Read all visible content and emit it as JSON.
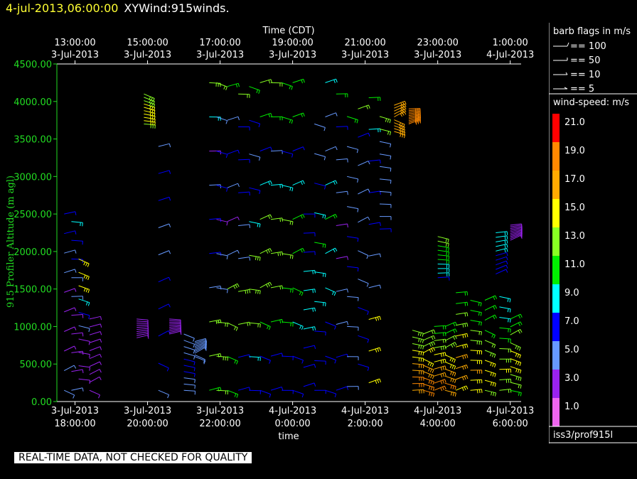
{
  "header": {
    "timestamp": "4-jul-2013,06:00:00",
    "dataset_name": "XYWind:915winds."
  },
  "colors": {
    "axis_green": "#22dd22",
    "title_yellow": "#ffff33",
    "background": "#000000"
  },
  "chart_data": {
    "type": "wind-barb time-height plot",
    "top_axis_title": "Time (CDT)",
    "top_ticks": [
      {
        "time": "13:00:00",
        "date": "3-Jul-2013"
      },
      {
        "time": "15:00:00",
        "date": "3-Jul-2013"
      },
      {
        "time": "17:00:00",
        "date": "3-Jul-2013"
      },
      {
        "time": "19:00:00",
        "date": "3-Jul-2013"
      },
      {
        "time": "21:00:00",
        "date": "3-Jul-2013"
      },
      {
        "time": "23:00:00",
        "date": "3-Jul-2013"
      },
      {
        "time": "1:00:00",
        "date": "4-Jul-2013"
      }
    ],
    "bottom_axis_title": "time",
    "bottom_ticks": [
      {
        "date": "3-Jul-2013",
        "time": "18:00:00"
      },
      {
        "date": "3-Jul-2013",
        "time": "20:00:00"
      },
      {
        "date": "3-Jul-2013",
        "time": "22:00:00"
      },
      {
        "date": "4-Jul-2013",
        "time": "0:00:00"
      },
      {
        "date": "4-Jul-2013",
        "time": "2:00:00"
      },
      {
        "date": "4-Jul-2013",
        "time": "4:00:00"
      },
      {
        "date": "4-Jul-2013",
        "time": "6:00:00"
      }
    ],
    "x_hours_range": [
      17.5,
      30.3
    ],
    "ylabel": "915 Profiler Altitude (m agl)",
    "ylim": [
      0,
      4500
    ],
    "y_ticks": [
      "0.00",
      "500.00",
      "1000.00",
      "1500.00",
      "2000.00",
      "2500.00",
      "3000.00",
      "3500.00",
      "4000.00",
      "4500.00"
    ],
    "y_tick_values": [
      0,
      500,
      1000,
      1500,
      2000,
      2500,
      3000,
      3500,
      4000,
      4500
    ],
    "profiles": [
      {
        "t": 17.7,
        "lo": 150,
        "hi": 2500,
        "spd": [
          4,
          4,
          3,
          3,
          3,
          3,
          4,
          5,
          6,
          7
        ]
      },
      {
        "t": 17.9,
        "lo": 150,
        "hi": 2400,
        "spd": [
          4,
          3,
          3,
          3,
          3,
          4,
          5,
          6,
          7,
          8
        ]
      },
      {
        "t": 18.1,
        "lo": 300,
        "hi": 1900,
        "spd": [
          3,
          3,
          3,
          3,
          4,
          6,
          9,
          14,
          15,
          15
        ]
      },
      {
        "t": 18.4,
        "lo": 150,
        "hi": 1100,
        "spd": [
          3,
          3,
          3,
          3,
          3,
          3,
          3,
          3,
          3,
          3
        ]
      },
      {
        "t": 19.7,
        "lo": 850,
        "hi": 1100,
        "spd": [
          3,
          3,
          3,
          3,
          3,
          3,
          3,
          3,
          3,
          3
        ]
      },
      {
        "t": 19.9,
        "lo": 3700,
        "hi": 4100,
        "spd": [
          13,
          14,
          14,
          15,
          15,
          15,
          14,
          13,
          13,
          13
        ]
      },
      {
        "t": 20.3,
        "lo": 150,
        "hi": 3400,
        "spd": [
          5,
          6,
          7,
          7,
          6,
          5,
          5,
          6,
          7,
          5
        ]
      },
      {
        "t": 20.6,
        "lo": 900,
        "hi": 1100,
        "spd": [
          3,
          3,
          3,
          3,
          3,
          3,
          3,
          3,
          3,
          3
        ]
      },
      {
        "t": 21.0,
        "lo": 150,
        "hi": 900,
        "spd": [
          5,
          5,
          5,
          6,
          7,
          6,
          5,
          5,
          5,
          5
        ]
      },
      {
        "t": 21.3,
        "lo": 600,
        "hi": 800,
        "spd": [
          5,
          5,
          5,
          5,
          5,
          5,
          5,
          5,
          5,
          5
        ]
      },
      {
        "t": 21.7,
        "lo": 150,
        "hi": 4250,
        "spd": [
          11,
          12,
          13,
          5,
          6,
          7,
          4,
          3,
          8,
          13
        ]
      },
      {
        "t": 21.9,
        "lo": 150,
        "hi": 4250,
        "spd": [
          12,
          13,
          12,
          5,
          4,
          3,
          7,
          6,
          5,
          12
        ]
      },
      {
        "t": 22.2,
        "lo": 150,
        "hi": 4200,
        "spd": [
          10,
          11,
          12,
          13,
          4,
          3,
          5,
          7,
          5,
          11
        ]
      },
      {
        "t": 22.5,
        "lo": 150,
        "hi": 4100,
        "spd": [
          7,
          7,
          12,
          13,
          5,
          4,
          6,
          7,
          7,
          12
        ]
      },
      {
        "t": 22.8,
        "lo": 150,
        "hi": 4200,
        "spd": [
          7,
          8,
          12,
          13,
          13,
          9,
          6,
          5,
          7,
          10
        ]
      },
      {
        "t": 23.1,
        "lo": 150,
        "hi": 4250,
        "spd": [
          6,
          7,
          10,
          13,
          13,
          12,
          8,
          7,
          11,
          12
        ]
      },
      {
        "t": 23.4,
        "lo": 150,
        "hi": 4250,
        "spd": [
          7,
          7,
          11,
          12,
          13,
          12,
          8,
          5,
          11,
          12
        ]
      },
      {
        "t": 23.7,
        "lo": 150,
        "hi": 4250,
        "spd": [
          6,
          7,
          10,
          11,
          12,
          12,
          9,
          6,
          11,
          11
        ]
      },
      {
        "t": 24.0,
        "lo": 150,
        "hi": 4250,
        "spd": [
          6,
          6,
          9,
          10,
          11,
          11,
          9,
          6,
          10,
          10
        ]
      },
      {
        "t": 24.3,
        "lo": 200,
        "hi": 2500,
        "spd": [
          6,
          6,
          7,
          8,
          9,
          9,
          8,
          6,
          6,
          6
        ]
      },
      {
        "t": 24.6,
        "lo": 150,
        "hi": 3700,
        "spd": [
          6,
          6,
          7,
          8,
          9,
          10,
          9,
          6,
          5,
          4
        ]
      },
      {
        "t": 24.9,
        "lo": 150,
        "hi": 4250,
        "spd": [
          7,
          6,
          7,
          8,
          9,
          10,
          8,
          5,
          4,
          9
        ]
      },
      {
        "t": 25.2,
        "lo": 150,
        "hi": 4100,
        "spd": [
          7,
          6,
          5,
          4,
          3,
          3,
          4,
          5,
          6,
          11
        ]
      },
      {
        "t": 25.5,
        "lo": 200,
        "hi": 3800,
        "spd": [
          5,
          5,
          5,
          5,
          6,
          6,
          5,
          5,
          4,
          10
        ]
      },
      {
        "t": 25.8,
        "lo": 500,
        "hi": 3900,
        "spd": [
          7,
          7,
          6,
          5,
          5,
          5,
          4,
          5,
          6,
          12
        ]
      },
      {
        "t": 26.1,
        "lo": 250,
        "hi": 4050,
        "spd": [
          15,
          15,
          14,
          5,
          5,
          6,
          6,
          7,
          8,
          11
        ]
      },
      {
        "t": 26.4,
        "lo": 2300,
        "hi": 3800,
        "spd": [
          6,
          5,
          5,
          5,
          4,
          4,
          4,
          5,
          12,
          13
        ]
      },
      {
        "t": 26.8,
        "lo": 3600,
        "hi": 3950,
        "spd": [
          17,
          17,
          17,
          16,
          16,
          16,
          16,
          16,
          16,
          16
        ]
      },
      {
        "t": 27.2,
        "lo": 3700,
        "hi": 3900,
        "spd": [
          18,
          18,
          18,
          18,
          18,
          18,
          18,
          18,
          18,
          18
        ]
      },
      {
        "t": 27.3,
        "lo": 150,
        "hi": 950,
        "spd": [
          17,
          18,
          18,
          17,
          16,
          15,
          14,
          13,
          13,
          13
        ]
      },
      {
        "t": 27.6,
        "lo": 150,
        "hi": 900,
        "spd": [
          18,
          19,
          18,
          17,
          16,
          15,
          14,
          13,
          12,
          12
        ]
      },
      {
        "t": 27.9,
        "lo": 150,
        "hi": 1000,
        "spd": [
          18,
          18,
          17,
          16,
          15,
          14,
          13,
          12,
          11,
          10
        ]
      },
      {
        "t": 28.0,
        "lo": 1650,
        "hi": 2200,
        "spd": [
          7,
          8,
          9,
          9,
          10,
          10,
          11,
          11,
          12,
          12
        ]
      },
      {
        "t": 28.2,
        "lo": 150,
        "hi": 1000,
        "spd": [
          17,
          18,
          17,
          16,
          15,
          14,
          13,
          12,
          11,
          10
        ]
      },
      {
        "t": 28.5,
        "lo": 150,
        "hi": 1450,
        "spd": [
          15,
          16,
          17,
          16,
          15,
          14,
          13,
          12,
          11,
          10
        ]
      },
      {
        "t": 28.9,
        "lo": 150,
        "hi": 1350,
        "spd": [
          14,
          15,
          16,
          15,
          14,
          13,
          12,
          11,
          10,
          10
        ]
      },
      {
        "t": 29.3,
        "lo": 150,
        "hi": 1350,
        "spd": [
          13,
          14,
          15,
          14,
          13,
          12,
          11,
          10,
          10,
          10
        ]
      },
      {
        "t": 29.6,
        "lo": 1700,
        "hi": 2250,
        "spd": [
          7,
          7,
          7,
          7,
          7,
          8,
          8,
          8,
          9,
          9
        ]
      },
      {
        "t": 29.7,
        "lo": 150,
        "hi": 1400,
        "spd": [
          12,
          13,
          14,
          13,
          12,
          11,
          10,
          9,
          9,
          9
        ]
      },
      {
        "t": 30.0,
        "lo": 150,
        "hi": 1100,
        "spd": [
          11,
          12,
          13,
          14,
          15,
          14,
          13,
          12,
          11,
          10
        ]
      },
      {
        "t": 30.0,
        "lo": 2150,
        "hi": 2350,
        "spd": [
          3,
          3,
          3,
          3,
          3,
          3,
          3,
          3,
          3,
          3
        ]
      }
    ]
  },
  "legend": {
    "barb_title": "barb flags in m/s",
    "barb_entries": [
      "== 100",
      "== 50",
      "== 10",
      "== 5"
    ],
    "speed_title": "wind-speed: m/s",
    "speed_bins": [
      {
        "label": "21.0",
        "color": "#ff0000"
      },
      {
        "label": "19.0",
        "color": "#ff8800"
      },
      {
        "label": "17.0",
        "color": "#ffaa00"
      },
      {
        "label": "15.0",
        "color": "#ffff00"
      },
      {
        "label": "13.0",
        "color": "#88ff22"
      },
      {
        "label": "11.0",
        "color": "#00ee00"
      },
      {
        "label": "9.0",
        "color": "#00ffff"
      },
      {
        "label": "7.0",
        "color": "#0000ff"
      },
      {
        "label": "5.0",
        "color": "#6699ff"
      },
      {
        "label": "3.0",
        "color": "#9922ee"
      },
      {
        "label": "1.0",
        "color": "#ee66ee"
      }
    ],
    "source": "iss3/prof915l"
  },
  "footer": {
    "quality_note": "REAL-TIME DATA, NOT CHECKED FOR QUALITY"
  }
}
